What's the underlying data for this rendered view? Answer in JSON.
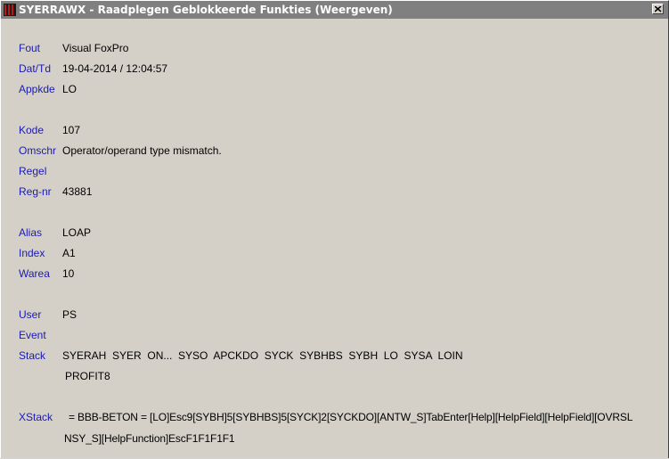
{
  "window": {
    "title": "SYERRAWX - Raadplegen Geblokkeerde Funkties (Weergeven)"
  },
  "fields": {
    "fout": {
      "label": "Fout",
      "value": "Visual FoxPro"
    },
    "dattd": {
      "label": "Dat/Td",
      "value": "19-04-2014 / 12:04:57"
    },
    "appkde": {
      "label": "Appkde",
      "value": "LO"
    },
    "kode": {
      "label": "Kode",
      "value": "107"
    },
    "omschr": {
      "label": "Omschr",
      "value": "Operator/operand type mismatch."
    },
    "regel": {
      "label": "Regel",
      "value": ""
    },
    "regnr": {
      "label": "Reg-nr",
      "value": "43881"
    },
    "alias": {
      "label": "Alias",
      "value": "LOAP"
    },
    "index": {
      "label": "Index",
      "value": "A1"
    },
    "warea": {
      "label": "Warea",
      "value": "10"
    },
    "user": {
      "label": "User",
      "value": "PS"
    },
    "event": {
      "label": "Event",
      "value": ""
    },
    "stack": {
      "label": "Stack",
      "value": "SYERAH  SYER  ON...  SYSO  APCKDO  SYCK  SYBHBS  SYBH  LO  SYSA  LOIN",
      "value2": "PROFIT8"
    },
    "xstack": {
      "label": "XStack",
      "value": "= BBB-BETON  = [LO]Esc9[SYBH]5[SYBHBS]5[SYCK]2[SYCKDO][ANTW_S]TabEnter[Help][HelpField][HelpField][OVRSL",
      "value2": "NSY_S][HelpFunction]EscF1F1F1F1"
    }
  }
}
